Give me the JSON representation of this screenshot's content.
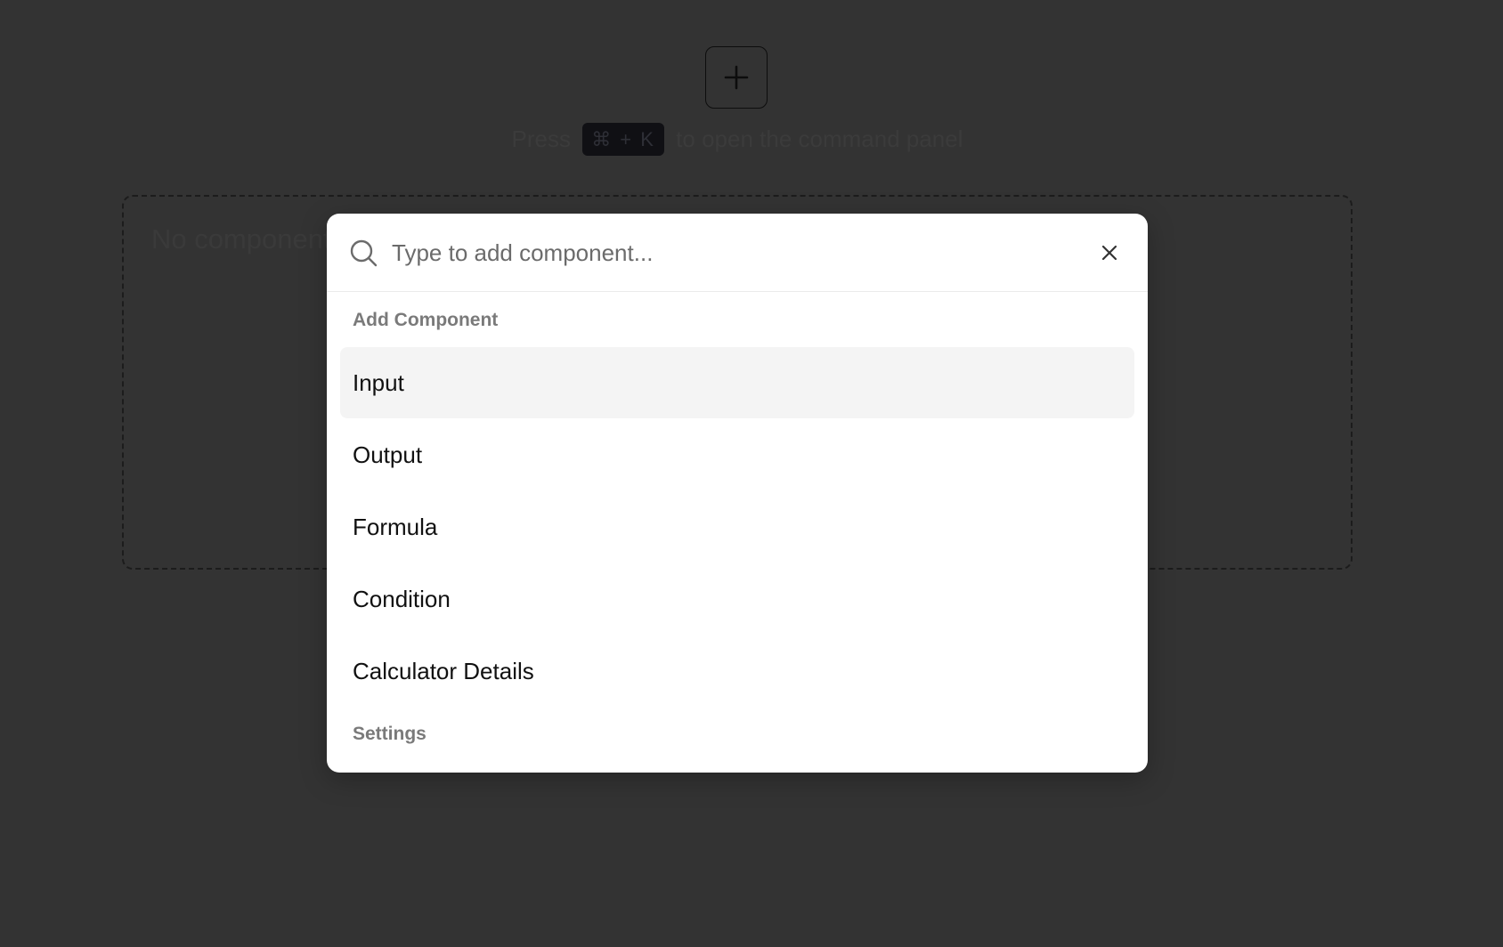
{
  "page": {
    "hint": {
      "before": "Press",
      "shortcut": "⌘ + K",
      "after": "to open the command panel"
    },
    "empty_state": "No components"
  },
  "command_panel": {
    "search_placeholder": "Type to add component...",
    "groups": [
      {
        "heading": "Add Component",
        "items": [
          {
            "label": "Input",
            "selected": true
          },
          {
            "label": "Output",
            "selected": false
          },
          {
            "label": "Formula",
            "selected": false
          },
          {
            "label": "Condition",
            "selected": false
          },
          {
            "label": "Calculator Details",
            "selected": false
          }
        ]
      },
      {
        "heading": "Settings",
        "items": []
      }
    ]
  },
  "icons": {
    "add": "plus-icon",
    "search": "search-icon",
    "close": "close-icon"
  },
  "colors": {
    "overlay_background": "#333333",
    "panel_background": "#ffffff",
    "selected_item_background": "#f4f4f4",
    "shortcut_badge": "#101014"
  }
}
